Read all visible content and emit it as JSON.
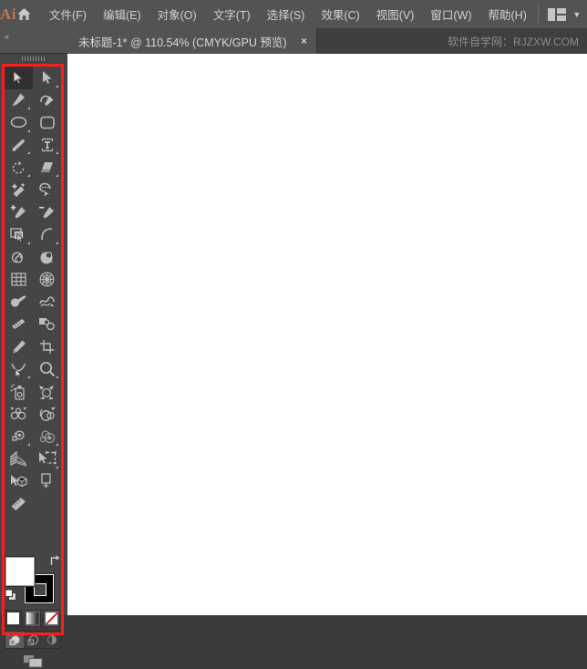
{
  "app": {
    "logo_text": "Ai",
    "logo_color": "#c07a4c",
    "home_icon": "home-icon",
    "arrange_icon": "arrange-documents-icon",
    "arrange_chevron": "▼"
  },
  "menu": {
    "items": [
      {
        "label": "文件(F)",
        "name": "menu-file"
      },
      {
        "label": "编辑(E)",
        "name": "menu-edit"
      },
      {
        "label": "对象(O)",
        "name": "menu-object"
      },
      {
        "label": "文字(T)",
        "name": "menu-type"
      },
      {
        "label": "选择(S)",
        "name": "menu-select"
      },
      {
        "label": "效果(C)",
        "name": "menu-effect"
      },
      {
        "label": "视图(V)",
        "name": "menu-view"
      },
      {
        "label": "窗口(W)",
        "name": "menu-window"
      },
      {
        "label": "帮助(H)",
        "name": "menu-help"
      }
    ]
  },
  "tabbar": {
    "collapse_arrows": "«",
    "document_title": "未标题-1* @ 110.54% (CMYK/GPU 预览)",
    "close_glyph": "×",
    "watermark": "软件自学网：RJZXW.COM"
  },
  "canvas": {
    "background_color": "#ffffff"
  },
  "toolpanel": {
    "highlight_color": "#fc1d1d",
    "active_tool": "selection-tool",
    "tools": [
      {
        "name": "selection-tool",
        "icon": "arrow-solid",
        "active": true,
        "flyout": false
      },
      {
        "name": "direct-selection-tool",
        "icon": "arrow-white",
        "active": false,
        "flyout": true
      },
      {
        "name": "pen-tool",
        "icon": "pen",
        "active": false,
        "flyout": true
      },
      {
        "name": "curvature-tool",
        "icon": "curvature",
        "active": false,
        "flyout": false
      },
      {
        "name": "ellipse-tool",
        "icon": "ellipse",
        "active": false,
        "flyout": true
      },
      {
        "name": "rectangle-tool",
        "icon": "rounded-rect",
        "active": false,
        "flyout": false
      },
      {
        "name": "paintbrush-tool",
        "icon": "paintbrush",
        "active": false,
        "flyout": true
      },
      {
        "name": "type-tool",
        "icon": "type",
        "active": false,
        "flyout": true
      },
      {
        "name": "rotate-tool",
        "icon": "rotate",
        "active": false,
        "flyout": true
      },
      {
        "name": "eraser-tool",
        "icon": "eraser",
        "active": false,
        "flyout": true
      },
      {
        "name": "magic-wand-tool",
        "icon": "magic-wand",
        "active": false,
        "flyout": false
      },
      {
        "name": "lasso-tool",
        "icon": "lasso",
        "active": false,
        "flyout": false
      },
      {
        "name": "add-anchor-point-tool",
        "icon": "pen-plus",
        "active": false,
        "flyout": false
      },
      {
        "name": "delete-anchor-point-tool",
        "icon": "pen-minus",
        "active": false,
        "flyout": false
      },
      {
        "name": "shape-builder-tool",
        "icon": "shape-builder",
        "active": false,
        "flyout": true
      },
      {
        "name": "arc-tool",
        "icon": "arc",
        "active": false,
        "flyout": true
      },
      {
        "name": "spiral-tool",
        "icon": "spiral",
        "active": false,
        "flyout": false
      },
      {
        "name": "blend-tool",
        "icon": "blend",
        "active": false,
        "flyout": false
      },
      {
        "name": "rectangular-grid-tool",
        "icon": "grid",
        "active": false,
        "flyout": false
      },
      {
        "name": "polar-grid-tool",
        "icon": "polar-grid",
        "active": false,
        "flyout": false
      },
      {
        "name": "blob-brush-tool",
        "icon": "blob-brush",
        "active": false,
        "flyout": false
      },
      {
        "name": "warp-tool",
        "icon": "warp",
        "active": false,
        "flyout": false
      },
      {
        "name": "width-tool",
        "icon": "width",
        "active": false,
        "flyout": false
      },
      {
        "name": "free-transform-tool",
        "icon": "free-transform",
        "active": false,
        "flyout": false
      },
      {
        "name": "pencil-tool",
        "icon": "pencil",
        "active": false,
        "flyout": false
      },
      {
        "name": "crop-image-tool",
        "icon": "crop",
        "active": false,
        "flyout": false
      },
      {
        "name": "scale-tool",
        "icon": "scale-node",
        "active": false,
        "flyout": true
      },
      {
        "name": "zoom-tool",
        "icon": "magnifier",
        "active": false,
        "flyout": true
      },
      {
        "name": "symbol-sprayer-tool",
        "icon": "symbol-sprayer",
        "active": false,
        "flyout": false
      },
      {
        "name": "symbol-shifter-tool",
        "icon": "symbol-shifter",
        "active": false,
        "flyout": false
      },
      {
        "name": "symbol-scruncher-tool",
        "icon": "symbol-scruncher",
        "active": false,
        "flyout": false
      },
      {
        "name": "symbol-sizer-tool",
        "icon": "symbol-sizer",
        "active": false,
        "flyout": false
      },
      {
        "name": "symbol-spinner-tool",
        "icon": "symbol-spinner",
        "active": false,
        "flyout": true
      },
      {
        "name": "symbol-stainer-tool",
        "icon": "symbol-stainer",
        "active": false,
        "flyout": true
      },
      {
        "name": "perspective-grid-tool",
        "icon": "perspective-grid",
        "active": false,
        "flyout": false
      },
      {
        "name": "perspective-selection-tool",
        "icon": "perspective-select",
        "active": false,
        "flyout": true
      },
      {
        "name": "3d-tool",
        "icon": "three-d",
        "active": false,
        "flyout": false
      },
      {
        "name": "artboard-tool",
        "icon": "artboard",
        "active": false,
        "flyout": false
      },
      {
        "name": "measure-tool",
        "icon": "ruler",
        "active": false,
        "flyout": false
      }
    ],
    "fill_color": "#ffffff",
    "stroke_color": "#000000",
    "swap_icon": "swap-fill-stroke-icon",
    "default_icon": "default-fill-stroke-icon",
    "color_modes": [
      {
        "name": "color-mode-button",
        "selected": true
      },
      {
        "name": "gradient-mode-button",
        "selected": false
      },
      {
        "name": "none-mode-button",
        "selected": false
      }
    ],
    "draw_modes": [
      {
        "name": "draw-normal-button",
        "selected": true
      },
      {
        "name": "draw-behind-button",
        "selected": false
      },
      {
        "name": "draw-inside-button",
        "selected": false
      }
    ],
    "screen_mode": "change-screen-mode-button"
  }
}
